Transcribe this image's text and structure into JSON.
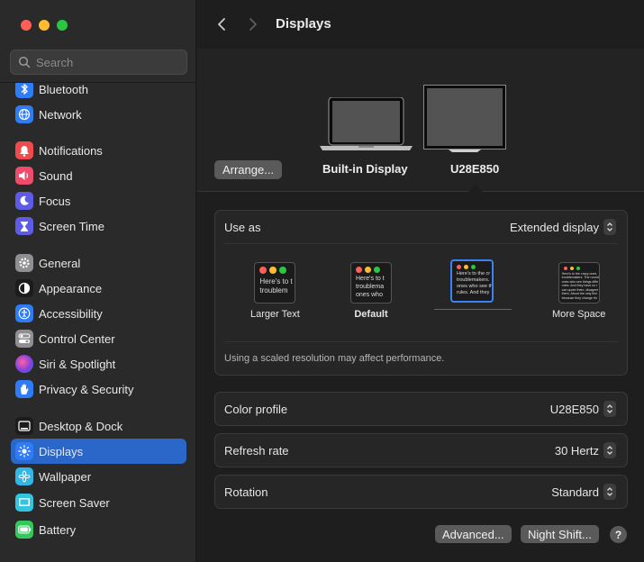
{
  "window": {
    "title": "Displays"
  },
  "search": {
    "placeholder": "Search"
  },
  "sidebar": {
    "items": [
      {
        "label": "Bluetooth",
        "icon": "bluetooth-icon",
        "color": "#2f7cf6"
      },
      {
        "label": "Network",
        "icon": "globe-icon",
        "color": "#2f7cf6"
      },
      {
        "label": "Notifications",
        "icon": "bell-icon",
        "color": "#ef4b4b"
      },
      {
        "label": "Sound",
        "icon": "speaker-icon",
        "color": "#ef4b6b"
      },
      {
        "label": "Focus",
        "icon": "moon-icon",
        "color": "#5e5ce6"
      },
      {
        "label": "Screen Time",
        "icon": "hourglass-icon",
        "color": "#5e5ce6"
      },
      {
        "label": "General",
        "icon": "gear-icon",
        "color": "#8e8e93"
      },
      {
        "label": "Appearance",
        "icon": "appearance-icon",
        "color": "#1c1c1c"
      },
      {
        "label": "Accessibility",
        "icon": "accessibility-icon",
        "color": "#2f7cf6"
      },
      {
        "label": "Control Center",
        "icon": "toggles-icon",
        "color": "#8e8e93"
      },
      {
        "label": "Siri & Spotlight",
        "icon": "siri-icon",
        "color": "#b44fd8"
      },
      {
        "label": "Privacy & Security",
        "icon": "hand-icon",
        "color": "#2f7cf6"
      },
      {
        "label": "Desktop & Dock",
        "icon": "dock-icon",
        "color": "#1c1c1c"
      },
      {
        "label": "Displays",
        "icon": "sun-icon",
        "color": "#2f7cf6",
        "active": true
      },
      {
        "label": "Wallpaper",
        "icon": "flower-icon",
        "color": "#33b5e5"
      },
      {
        "label": "Screen Saver",
        "icon": "screensaver-icon",
        "color": "#33c4e0"
      },
      {
        "label": "Battery",
        "icon": "battery-icon",
        "color": "#34c759"
      }
    ]
  },
  "displays": {
    "arrange_label": "Arrange...",
    "builtin_name": "Built-in Display",
    "external_name": "U28E850"
  },
  "use_as": {
    "label": "Use as",
    "value": "Extended display"
  },
  "resolution": {
    "options": [
      {
        "label": "Larger Text",
        "preview_text": "Here's to t\ntroublem"
      },
      {
        "label": "Default",
        "preview_text": "Here's to t\ntroublema\nones who"
      },
      {
        "label": "",
        "preview_text": "Here's to the cr\ntroublemakers.\nones who see th\nrules. And they",
        "selected": true
      },
      {
        "label": "More Space",
        "preview_text": "Here's to the crazy ones\ntroublemakers. The round\nones who see things diffe\nrules. And they have no r\ncan quote them, disagree\nthem. About the only thin\nbecause they change thi"
      }
    ],
    "note": "Using a scaled resolution may affect performance."
  },
  "color_profile": {
    "label": "Color profile",
    "value": "U28E850"
  },
  "refresh_rate": {
    "label": "Refresh rate",
    "value": "30 Hertz"
  },
  "rotation": {
    "label": "Rotation",
    "value": "Standard"
  },
  "buttons": {
    "advanced": "Advanced...",
    "night_shift": "Night Shift...",
    "help": "?"
  }
}
